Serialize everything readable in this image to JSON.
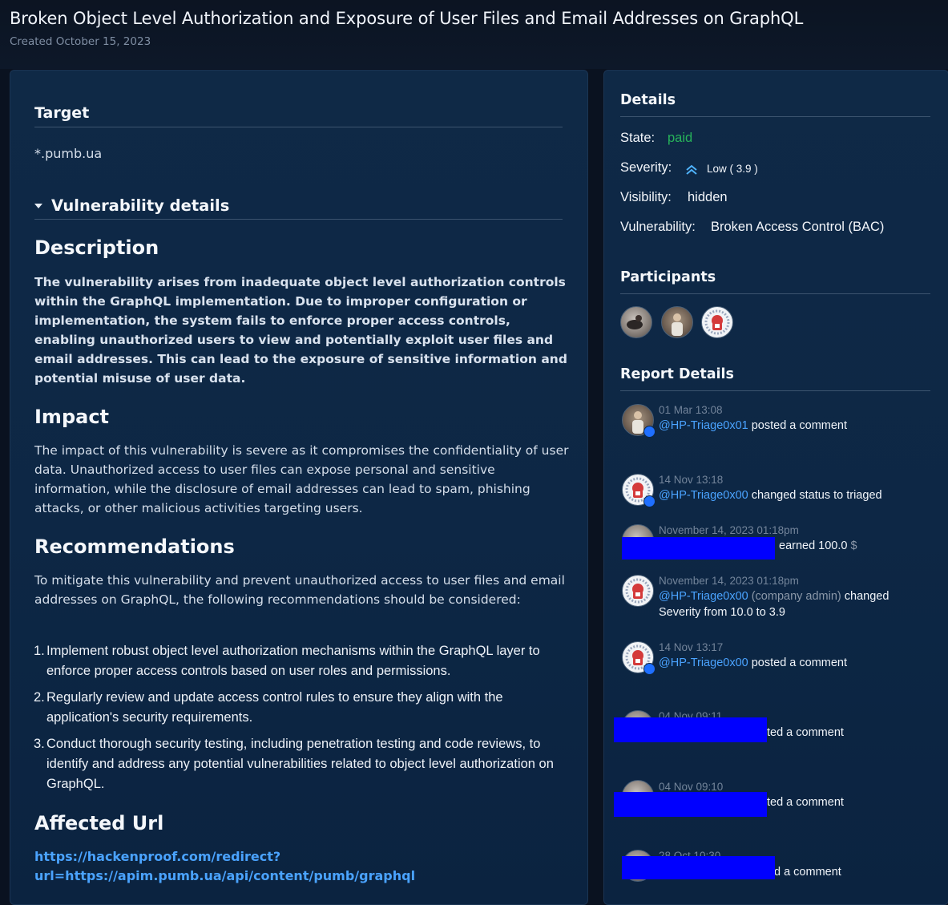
{
  "header": {
    "title": "Broken Object Level Authorization and Exposure of User Files and Email Addresses on GraphQL",
    "created": "Created October 15, 2023"
  },
  "main": {
    "target_heading": "Target",
    "target_value": "*.pumb.ua",
    "vuln_details_heading": "Vulnerability details",
    "description_heading": "Description",
    "description_text": "The vulnerability arises from inadequate object level authorization controls within the GraphQL implementation. Due to improper configuration or implementation, the system fails to enforce proper access controls, enabling unauthorized users to view and potentially exploit user files and email addresses. This can lead to the exposure of sensitive information and potential misuse of user data.",
    "impact_heading": "Impact",
    "impact_text": "The impact of this vulnerability is severe as it compromises the confidentiality of user data. Unauthorized access to user files can expose personal and sensitive information, while the disclosure of email addresses can lead to spam, phishing attacks, or other malicious activities targeting users.",
    "recommendations_heading": "Recommendations",
    "recommendations_intro": "To mitigate this vulnerability and prevent unauthorized access to user files and email addresses on GraphQL, the following recommendations should be considered:",
    "recommendations": [
      {
        "num": "1.",
        "text": "Implement robust object level authorization mechanisms within the GraphQL layer to enforce proper access controls based on user roles and permissions."
      },
      {
        "num": "2.",
        "text": "Regularly review and update access control rules to ensure they align with the application's security requirements."
      },
      {
        "num": "3.",
        "text": "Conduct thorough security testing, including penetration testing and code reviews, to identify and address any potential vulnerabilities related to object level authorization on GraphQL."
      }
    ],
    "affected_url_heading": "Affected Url",
    "affected_url_line1": "https://hackenproof.com/redirect?",
    "affected_url_line2": "url=https://apim.pumb.ua/api/content/pumb/graphql"
  },
  "sidebar": {
    "details_heading": "Details",
    "state_label": "State:",
    "state_value": "paid",
    "severity_label": "Severity:",
    "severity_value": "Low ( 3.9 )",
    "visibility_label": "Visibility:",
    "visibility_value": "hidden",
    "vulnerability_label": "Vulnerability:",
    "vulnerability_value": "Broken Access Control (BAC)",
    "participants_heading": "Participants",
    "report_details_heading": "Report Details",
    "activity": [
      {
        "time": "01 Mar 13:08",
        "user": "@HP-Triage0x01",
        "action": " posted a comment"
      },
      {
        "time": "14 Nov 13:18",
        "user": "@HP-Triage0x00",
        "action": " changed status to triaged"
      },
      {
        "time": "November 14, 2023 01:18pm",
        "action": "earned 100.0",
        "currency": "$"
      },
      {
        "time": "November 14, 2023 01:18pm",
        "user": "@HP-Triage0x00",
        "role": " (company admin)",
        "action": " changed",
        "action2": "Severity from 10.0 to 3.9"
      },
      {
        "time": "14 Nov 13:17",
        "user": "@HP-Triage0x00",
        "action": " posted a comment"
      },
      {
        "time": "04 Nov 09:11",
        "action": "ted a comment"
      },
      {
        "time": "04 Nov 09:10",
        "action": "ted a comment"
      },
      {
        "time": "28 Oct 10:30",
        "action": "d a comment"
      }
    ]
  },
  "colors": {
    "accent_link": "#4aa3ff",
    "state_paid": "#27b35a",
    "severity_low": "#4fb3ff",
    "redaction": "#0000ff",
    "panel_bg": "#0d2745"
  }
}
